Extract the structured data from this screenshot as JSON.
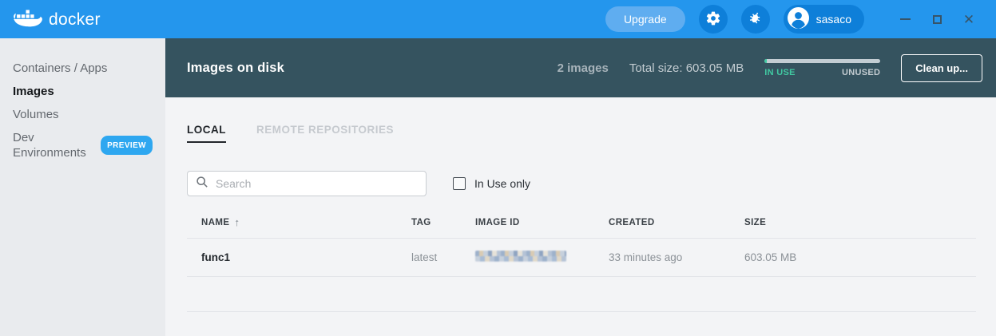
{
  "topbar": {
    "brand": "docker",
    "upgrade_label": "Upgrade",
    "username": "sasaco",
    "icons": {
      "logo": "docker-whale",
      "settings": "gear",
      "feedback": "bug",
      "user": "person-avatar"
    },
    "window_controls": {
      "minimize": "minimize",
      "maximize": "maximize",
      "close": "✕"
    }
  },
  "sidebar": {
    "items": [
      {
        "label": "Containers / Apps",
        "active": false
      },
      {
        "label": "Images",
        "active": true
      },
      {
        "label": "Volumes",
        "active": false
      },
      {
        "label": "Dev Environments",
        "active": false,
        "badge": "PREVIEW"
      }
    ]
  },
  "header": {
    "title": "Images on disk",
    "count": "2 images",
    "total_size": "Total size: 603.05 MB",
    "usage": {
      "in_use_label": "IN USE",
      "unused_label": "UNUSED",
      "in_use_fraction": 0.02
    },
    "cleanup_label": "Clean up..."
  },
  "tabs": [
    {
      "label": "LOCAL",
      "active": true
    },
    {
      "label": "REMOTE REPOSITORIES",
      "active": false
    }
  ],
  "filters": {
    "search_placeholder": "Search",
    "search_value": "",
    "search_icon": "magnifier",
    "in_use_only_label": "In Use only",
    "in_use_only_checked": false
  },
  "table": {
    "columns": [
      "NAME",
      "TAG",
      "IMAGE ID",
      "CREATED",
      "SIZE"
    ],
    "sort": {
      "column": "NAME",
      "direction": "asc",
      "icon": "↑"
    },
    "rows": [
      {
        "name": "func1",
        "tag": "latest",
        "image_id_redacted": true,
        "created": "33 minutes ago",
        "size": "603.05 MB"
      }
    ]
  },
  "colors": {
    "accent_blue": "#2496ED",
    "pill_blue": "#0E7FD9",
    "preview_blue": "#2EA7F0",
    "header_teal": "#35535F",
    "in_use_green": "#41C9A2",
    "content_bg": "#F3F4F6",
    "sidebar_bg": "#E9EBEE"
  }
}
